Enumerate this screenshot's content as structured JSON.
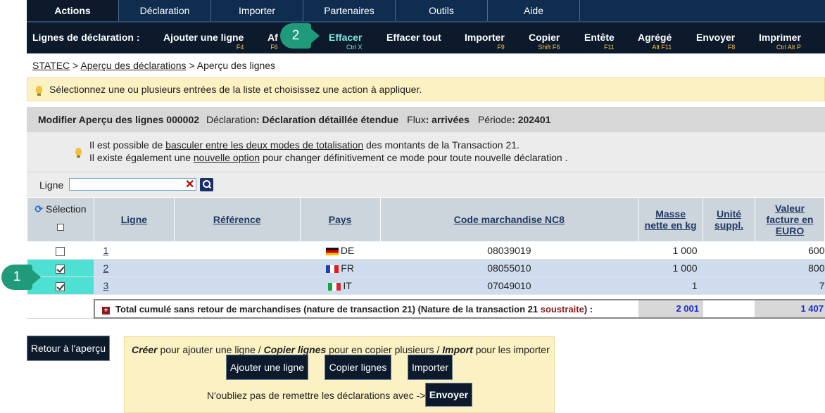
{
  "topnav": {
    "tabs": [
      "Actions",
      "Déclaration",
      "Importer",
      "Partenaires",
      "Outils",
      "Aide"
    ]
  },
  "subnav": {
    "label": "Lignes de déclaration :",
    "actions": [
      {
        "label": "Ajouter une ligne",
        "key": "F4"
      },
      {
        "label": "Af",
        "key": "F6"
      },
      {
        "label": "Effacer",
        "key": "Ctrl X"
      },
      {
        "label": "Effacer tout",
        "key": ""
      },
      {
        "label": "Importer",
        "key": "F9"
      },
      {
        "label": "Copier",
        "key": "Shift F6"
      },
      {
        "label": "Entête",
        "key": "F11"
      },
      {
        "label": "Agrégé",
        "key": "Alt F11"
      },
      {
        "label": "Envoyer",
        "key": "F8"
      },
      {
        "label": "Imprimer",
        "key": "Ctrl Alt P"
      }
    ]
  },
  "badges": {
    "one": "1",
    "two": "2"
  },
  "breadcrumb": {
    "root": "STATEC",
    "sep1": ">",
    "parent": "Aperçu des déclarations",
    "sep2": ">",
    "current": "Aperçu des lignes"
  },
  "info_message": "Sélectionnez une ou plusieurs entrées de la liste et choisissez une action à appliquer.",
  "panel": {
    "title": "Modifier Aperçu des lignes 000002",
    "decl_label": "Déclaration",
    "decl_value": "Déclaration détaillée étendue",
    "flux_label": "Flux",
    "flux_value": "arrivées",
    "period_label": "Période",
    "period_value": "202401",
    "line1_a": "Il est possible de ",
    "line1_link": "basculer entre les deux modes de totalisation",
    "line1_b": " des montants de la Transaction 21.",
    "line2_a": "Il existe également une ",
    "line2_link": "nouvelle option",
    "line2_b": " pour changer définitivement ce mode pour toute nouvelle déclaration ."
  },
  "filter": {
    "label": "Ligne",
    "value": ""
  },
  "table": {
    "headers": {
      "selection": "Sélection",
      "ligne": "Ligne",
      "reference": "Référence",
      "pays": "Pays",
      "code": "Code marchandise NC8",
      "masse_1": "Masse",
      "masse_2": "nette en kg",
      "unite_1": "Unité",
      "unite_2": "suppl.",
      "valeur_1": "Valeur",
      "valeur_2": "facture en",
      "valeur_3": "EURO"
    },
    "rows": [
      {
        "checked": false,
        "ligne": "1",
        "reference": "",
        "pays": "DE",
        "code": "08039019",
        "masse": "1 000",
        "unite": "",
        "valeur": "600"
      },
      {
        "checked": true,
        "ligne": "2",
        "reference": "",
        "pays": "FR",
        "code": "08055010",
        "masse": "1 000",
        "unite": "",
        "valeur": "800"
      },
      {
        "checked": true,
        "ligne": "3",
        "reference": "",
        "pays": "IT",
        "code": "07049010",
        "masse": "1",
        "unite": "",
        "valeur": "7"
      }
    ]
  },
  "total": {
    "label_a": "Total cumulé sans retour de marchandises (nature de transaction 21) (Nature de la transaction 21 ",
    "label_red": "soustraite",
    "label_b": ") :",
    "masse": "2 001",
    "valeur": "1 407"
  },
  "buttons": {
    "back": "Retour à l'aperçu",
    "add": "Ajouter une ligne",
    "copy": "Copier lignes",
    "import": "Importer",
    "send": "Envoyer"
  },
  "create_box": {
    "c1": "Créer",
    "t1": " pour ajouter une ligne / ",
    "c2": "Copier lignes",
    "t2": " pour en copier plusieurs / ",
    "c3": "Import",
    "t3": " pour les importer",
    "note": "N'oubliez pas de remettre les déclarations avec ->"
  }
}
